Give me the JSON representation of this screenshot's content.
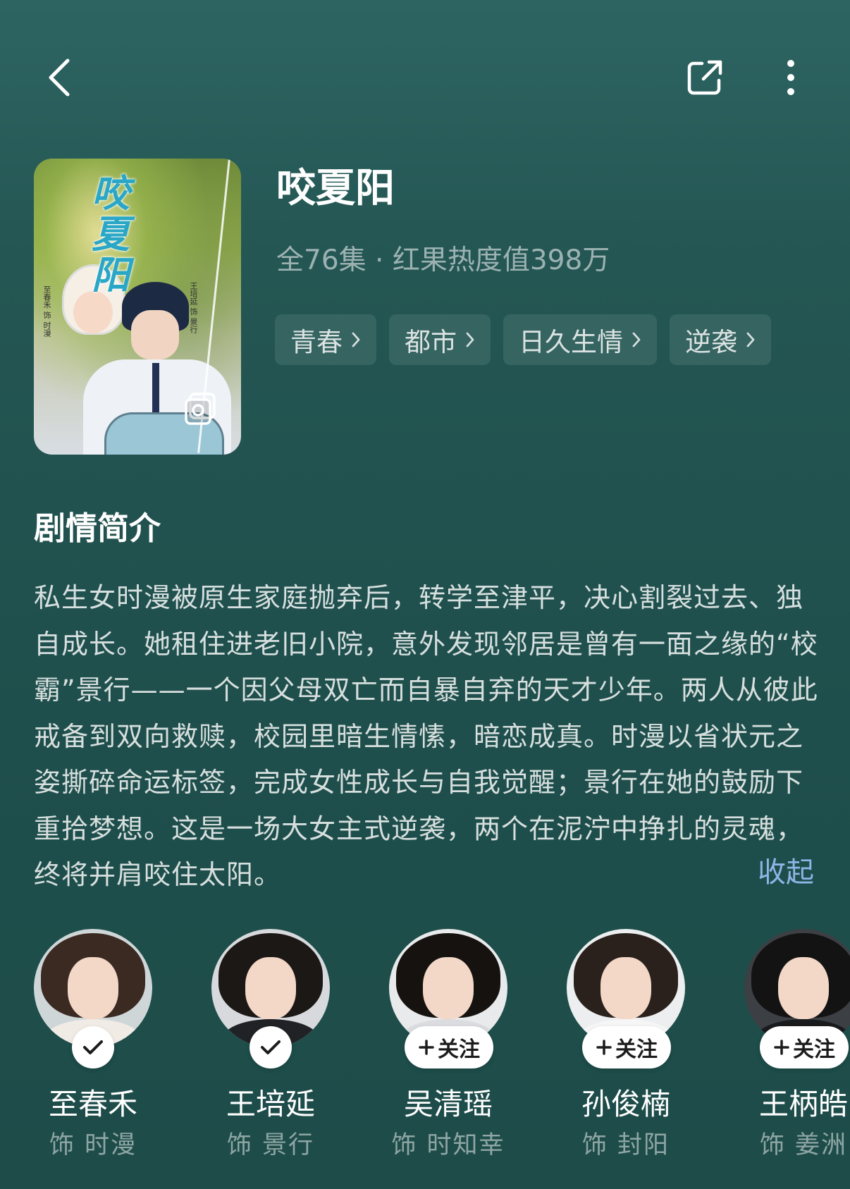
{
  "nav": {
    "back_icon": "chevron-left-icon",
    "share_icon": "share-icon",
    "more_icon": "more-vertical-icon"
  },
  "poster": {
    "title_text": "咬夏阳",
    "left_names": "至春禾 饰 时漫",
    "right_names": "王培延 饰 景行",
    "gallery_icon": "gallery-icon"
  },
  "show": {
    "title": "咬夏阳",
    "meta": "全76集 · 红果热度值398万",
    "tags": [
      "青春",
      "都市",
      "日久生情",
      "逆袭"
    ]
  },
  "synopsis": {
    "heading": "剧情简介",
    "text": "私生女时漫被原生家庭抛弃后，转学至津平，决心割裂过去、独自成长。她租住进老旧小院，意外发现邻居是曾有一面之缘的“校霸”景行——一个因父母双亡而自暴自弃的天才少年。两人从彼此戒备到双向救赎，校园里暗生情愫，暗恋成真。时漫以省状元之姿撕碎命运标签，完成女性成长与自我觉醒；景行在她的鼓励下重拾梦想。这是一场大女主式逆袭，两个在泥泞中挣扎的灵魂，终将并肩咬住太阳。",
    "collapse_label": "收起"
  },
  "cast": [
    {
      "name": "至春禾",
      "role": "饰 时漫",
      "followed": true,
      "follow_label": ""
    },
    {
      "name": "王培延",
      "role": "饰 景行",
      "followed": true,
      "follow_label": ""
    },
    {
      "name": "吴清瑶",
      "role": "饰 时知幸",
      "followed": false,
      "follow_label": "关注"
    },
    {
      "name": "孙俊楠",
      "role": "饰 封阳",
      "followed": false,
      "follow_label": "关注"
    },
    {
      "name": "王柄皓",
      "role": "饰 姜洲",
      "followed": false,
      "follow_label": "关注"
    }
  ],
  "colors": {
    "background_top": "#2d6462",
    "background_bottom": "#1d4c49",
    "link": "#8fb4e6"
  }
}
